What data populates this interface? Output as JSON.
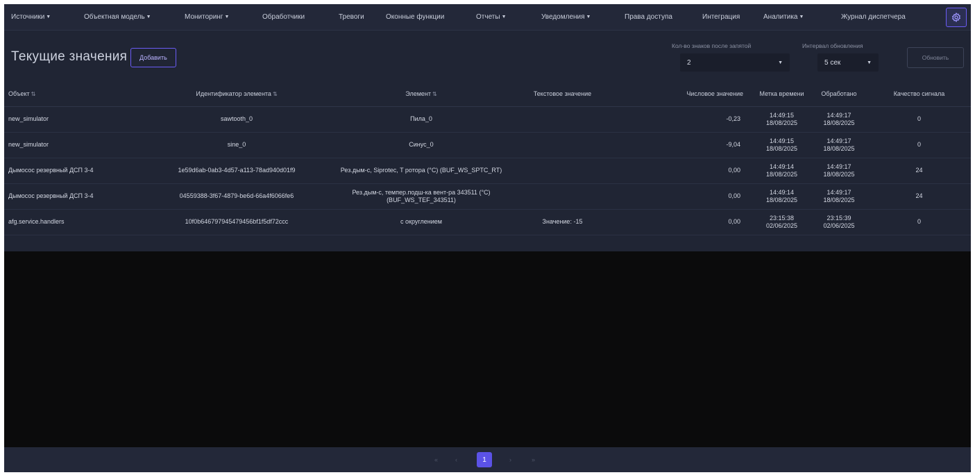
{
  "nav": {
    "items": [
      {
        "label": "Источники",
        "dropdown": true
      },
      {
        "label": "Объектная модель",
        "dropdown": true
      },
      {
        "label": "Мониторинг",
        "dropdown": true
      },
      {
        "label": "Обработчики",
        "dropdown": false
      },
      {
        "label": "Тревоги",
        "dropdown": false
      },
      {
        "label": "Оконные функции",
        "dropdown": false
      },
      {
        "label": "Отчеты",
        "dropdown": true
      },
      {
        "label": "Уведомления",
        "dropdown": true
      },
      {
        "label": "Права доступа",
        "dropdown": false
      },
      {
        "label": "Интеграция",
        "dropdown": false
      },
      {
        "label": "Аналитика",
        "dropdown": true
      },
      {
        "label": "Журнал диспетчера",
        "dropdown": false
      }
    ],
    "settings_icon": "gear-icon"
  },
  "header": {
    "title": "Текущие значения",
    "add_label": "Добавить",
    "decimals_label": "Кол-во знаков после запятой",
    "decimals_value": "2",
    "interval_label": "Интервал обновления",
    "interval_value": "5 сек",
    "refresh_label": "Обновить"
  },
  "table": {
    "columns": [
      {
        "label": "Объект",
        "sortable": true
      },
      {
        "label": "Идентификатор элемента",
        "sortable": true
      },
      {
        "label": "Элемент",
        "sortable": true
      },
      {
        "label": "Текстовое значение",
        "sortable": false
      },
      {
        "label": "Числовое значение",
        "sortable": false
      },
      {
        "label": "Метка времени",
        "sortable": false
      },
      {
        "label": "Обработано",
        "sortable": false
      },
      {
        "label": "Качество сигнала",
        "sortable": false
      }
    ],
    "rows": [
      {
        "object": "new_simulator",
        "id": "sawtooth_0",
        "element": "Пила_0",
        "text": "",
        "number": "-0,23",
        "ts_time": "14:49:15",
        "ts_date": "18/08/2025",
        "proc_time": "14:49:17",
        "proc_date": "18/08/2025",
        "quality": "0"
      },
      {
        "object": "new_simulator",
        "id": "sine_0",
        "element": "Синус_0",
        "text": "",
        "number": "-9,04",
        "ts_time": "14:49:15",
        "ts_date": "18/08/2025",
        "proc_time": "14:49:17",
        "proc_date": "18/08/2025",
        "quality": "0"
      },
      {
        "object": "Дымосос резервный ДСП 3-4",
        "id": "1e59d6ab-0ab3-4d57-a113-78ad940d01f9",
        "element": "Рез.дым-с, Siprotec, T ротора (°C) (BUF_WS_SPTC_RT)",
        "text": "",
        "number": "0,00",
        "ts_time": "14:49:14",
        "ts_date": "18/08/2025",
        "proc_time": "14:49:17",
        "proc_date": "18/08/2025",
        "quality": "24"
      },
      {
        "object": "Дымосос резервный ДСП 3-4",
        "id": "04559388-3f67-4879-be6d-66a4f6066fe6",
        "element": "Рез.дым-с, темпер.подш-ка вент-ра 343511 (°C) (BUF_WS_TEF_343511)",
        "text": "",
        "number": "0,00",
        "ts_time": "14:49:14",
        "ts_date": "18/08/2025",
        "proc_time": "14:49:17",
        "proc_date": "18/08/2025",
        "quality": "24"
      },
      {
        "object": "afg.service.handlers",
        "id": "10f0b646797945479456bf1f5df72ccc",
        "element": "с округлением",
        "text": "Значение: -15",
        "number": "0,00",
        "ts_time": "23:15:38",
        "ts_date": "02/06/2025",
        "proc_time": "23:15:39",
        "proc_date": "02/06/2025",
        "quality": "0"
      }
    ]
  },
  "pagination": {
    "first": "«",
    "prev": "‹",
    "current": "1",
    "next": "›",
    "last": "»"
  },
  "colors": {
    "accent": "#5b52e6",
    "background": "#202534",
    "empty_area": "#0b0b0c"
  }
}
